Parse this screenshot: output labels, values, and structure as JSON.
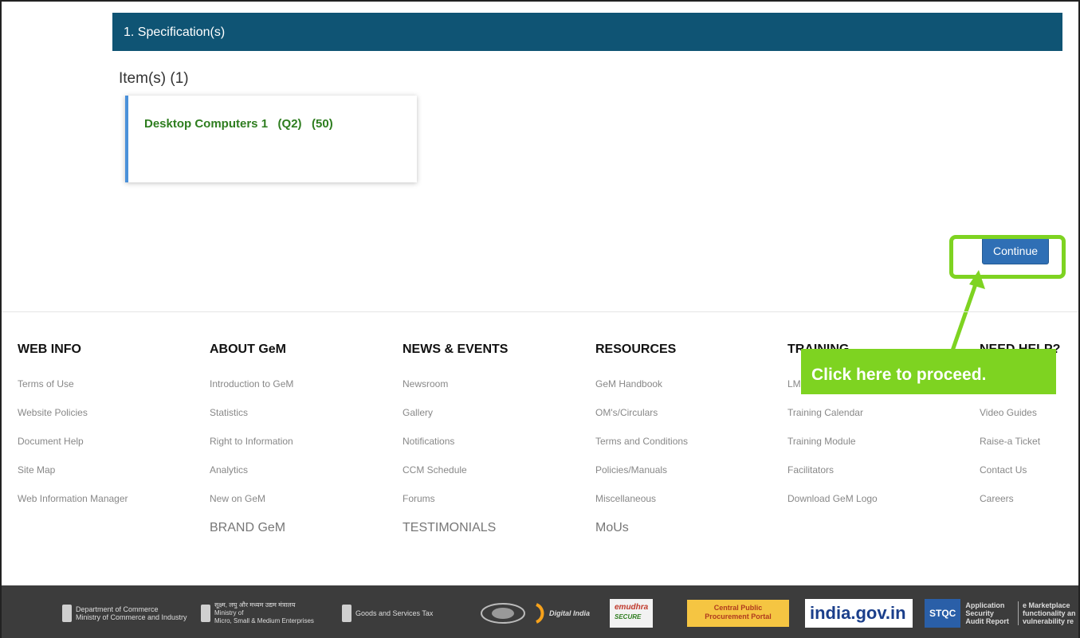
{
  "spec": {
    "section_title": "1. Specification(s)",
    "items_title": "Item(s) (1)",
    "item_label": "Desktop Computers 1   (Q2)   (50)"
  },
  "actions": {
    "continue_label": "Continue",
    "callout_text": "Click here to proceed."
  },
  "footer": {
    "web_info": {
      "title": "WEB INFO",
      "links": [
        "Terms of Use",
        "Website Policies",
        "Document Help",
        "Site Map",
        "Web Information Manager"
      ]
    },
    "about": {
      "title": "ABOUT GeM",
      "links": [
        "Introduction to GeM",
        "Statistics",
        "Right to Information",
        "Analytics",
        "New on GeM"
      ],
      "extra": "BRAND GeM"
    },
    "news": {
      "title": "NEWS & EVENTS",
      "links": [
        "Newsroom",
        "Gallery",
        "Notifications",
        "CCM Schedule",
        "Forums"
      ],
      "extra": "TESTIMONIALS"
    },
    "resources": {
      "title": "RESOURCES",
      "links": [
        "GeM Handbook",
        "OM's/Circulars",
        "Terms and Conditions",
        "Policies/Manuals",
        "Miscellaneous"
      ],
      "extra": "MoUs"
    },
    "training": {
      "title": "TRAINING",
      "links": [
        "LMS",
        "Training Calendar",
        "Training Module",
        "Facilitators",
        "Download GeM Logo"
      ]
    },
    "help": {
      "title": "NEED HELP?",
      "links": [
        "",
        "Video Guides",
        "Raise-a Ticket",
        "Contact Us",
        "Careers"
      ]
    }
  },
  "bottom_logos": {
    "commerce_line1": "Department of Commerce",
    "commerce_line2": "Ministry of Commerce and Industry",
    "msme_line1": "सूक्ष्म, लघु और मध्यम उद्यम मंत्रालय",
    "msme_line2": "Ministry of",
    "msme_line3": "Micro, Small & Medium Enterprises",
    "gst": "Goods and Services Tax",
    "digital_india": "Digital India",
    "emudhra": "emudhra",
    "emudhra_sub": "SECURE",
    "cppp_line1": "Central Public",
    "cppp_line2": "Procurement Portal",
    "india_gov": "india.gov.in",
    "stqc": "STQC",
    "stqc_line1": "Application",
    "stqc_line2": "Security",
    "stqc_line3": "Audit Report",
    "marketplace_line1": "e Marketplace",
    "marketplace_line2": "functionality an",
    "marketplace_line3": "vulnerability re"
  },
  "colors": {
    "header_bar": "#0f5474",
    "accent_green": "#7ed321",
    "button_blue": "#2f6fb5",
    "item_text_green": "#2e7d1f"
  }
}
